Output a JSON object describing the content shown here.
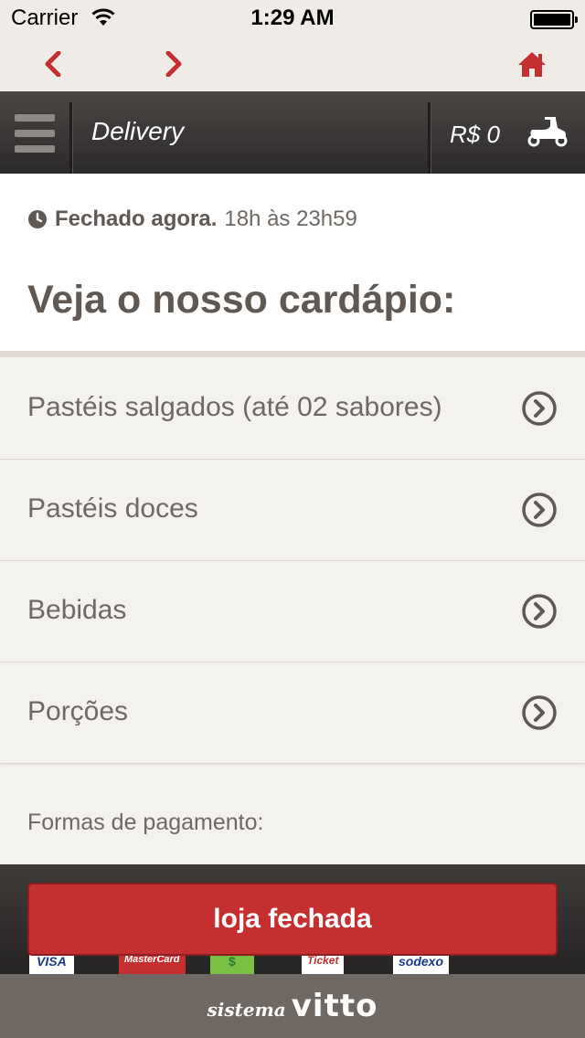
{
  "status_bar": {
    "carrier": "Carrier",
    "time": "1:29 AM"
  },
  "browser_nav": {
    "back_icon": "chevron-left-icon",
    "forward_icon": "chevron-right-icon",
    "home_icon": "home-icon"
  },
  "header": {
    "title": "Delivery",
    "cart_total": "R$ 0",
    "cart_icon": "scooter-icon"
  },
  "store": {
    "status": "Fechado agora.",
    "hours": "18h às 23h59"
  },
  "menu": {
    "title": "Veja o nosso cardápio:",
    "categories": [
      {
        "label": "Pastéis salgados (até 02 sabores)"
      },
      {
        "label": "Pastéis doces"
      },
      {
        "label": "Bebidas"
      },
      {
        "label": "Porções"
      }
    ]
  },
  "payment": {
    "label": "Formas de pagamento:",
    "methods": [
      "VISA",
      "MasterCard",
      "$",
      "Ticket",
      "sodexo"
    ]
  },
  "action": {
    "button_label": "loja fechada"
  },
  "footer": {
    "brand_prefix": "sistema",
    "brand_name": "vitto"
  },
  "colors": {
    "accent_red": "#c62f30",
    "text_brown": "#5f5853",
    "header_dark": "#2c2a29"
  }
}
